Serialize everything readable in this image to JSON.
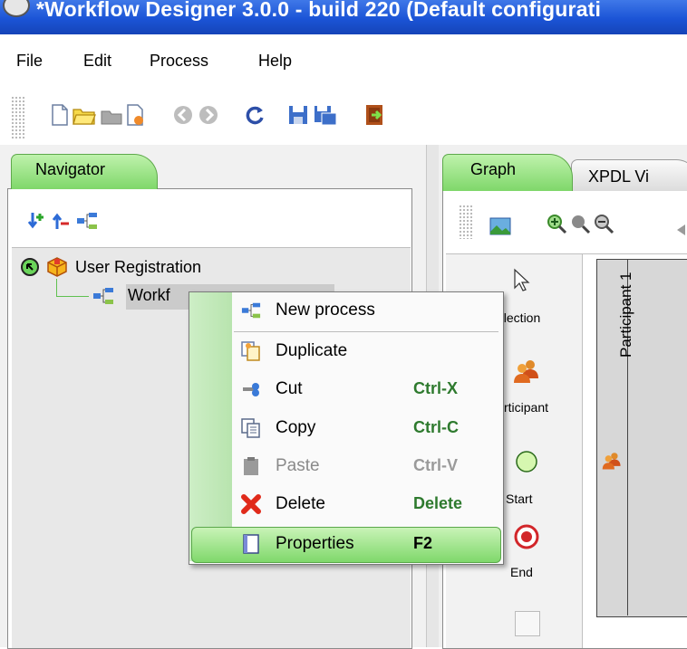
{
  "window": {
    "title": "*Workflow Designer 3.0.0 - build 220 (Default configurati"
  },
  "menubar": {
    "items": [
      "File",
      "Edit",
      "Process",
      "Help"
    ]
  },
  "navigator": {
    "tab_label": "Navigator",
    "tree": {
      "root": "User Registration",
      "child": "Workf"
    }
  },
  "graph": {
    "tabs": [
      "Graph",
      "XPDL Vi"
    ],
    "palette": {
      "selection": "election",
      "participant": "rticipant",
      "start": "Start",
      "end": "End"
    },
    "pool_label": "Participant 1"
  },
  "context_menu": {
    "items": [
      {
        "label": "New process",
        "shortcut": "",
        "icon": "new-process-icon",
        "enabled": true
      },
      {
        "label": "Duplicate",
        "shortcut": "",
        "icon": "duplicate-icon",
        "enabled": true
      },
      {
        "label": "Cut",
        "shortcut": "Ctrl-X",
        "icon": "cut-icon",
        "enabled": true
      },
      {
        "label": "Copy",
        "shortcut": "Ctrl-C",
        "icon": "copy-icon",
        "enabled": true
      },
      {
        "label": "Paste",
        "shortcut": "Ctrl-V",
        "icon": "paste-icon",
        "enabled": false
      },
      {
        "label": "Delete",
        "shortcut": "Delete",
        "icon": "delete-icon",
        "enabled": true
      },
      {
        "label": "Properties",
        "shortcut": "F2",
        "icon": "properties-icon",
        "enabled": true,
        "highlighted": true
      }
    ]
  },
  "colors": {
    "accent_green": "#7fd76a",
    "title_blue": "#1b54d6",
    "shortcut_green": "#2e7a2e"
  }
}
